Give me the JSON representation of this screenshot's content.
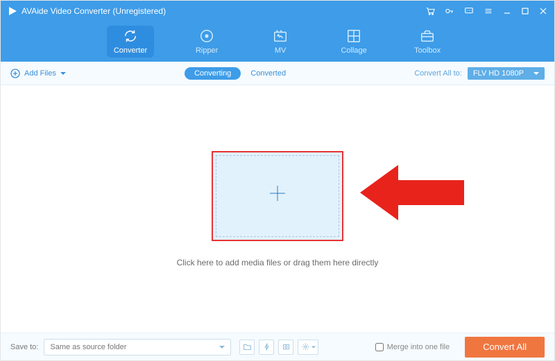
{
  "title": "AVAide Video Converter (Unregistered)",
  "nav": {
    "converter": "Converter",
    "ripper": "Ripper",
    "mv": "MV",
    "collage": "Collage",
    "toolbox": "Toolbox"
  },
  "toolbar": {
    "add_files": "Add Files",
    "converting_tab": "Converting",
    "converted_tab": "Converted",
    "convert_all_to_label": "Convert All to:",
    "format_selected": "FLV HD 1080P"
  },
  "main": {
    "instruction": "Click here to add media files or drag them here directly"
  },
  "bottom": {
    "save_to_label": "Save to:",
    "save_to_value": "Same as source folder",
    "merge_label": "Merge into one file",
    "convert_all_button": "Convert All"
  }
}
